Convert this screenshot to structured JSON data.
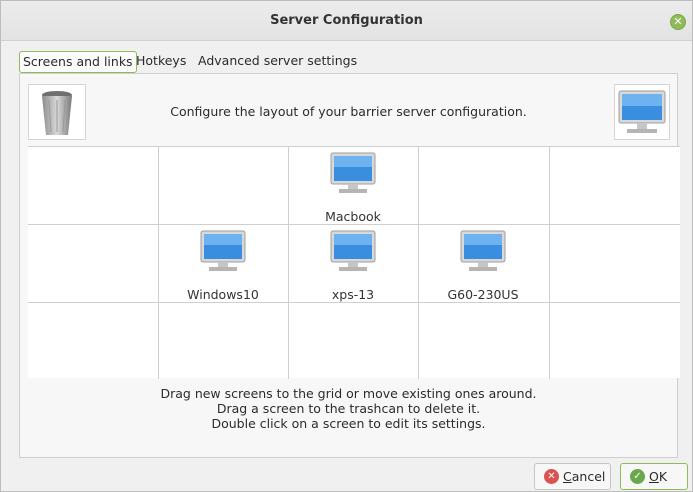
{
  "window": {
    "title": "Server Configuration",
    "close_icon": "close-icon"
  },
  "tabs": [
    {
      "label": "Screens and links",
      "active": true
    },
    {
      "label": "Hotkeys",
      "active": false
    },
    {
      "label": "Advanced server settings",
      "active": false
    }
  ],
  "panel": {
    "instruction": "Configure the layout of your barrier server configuration.",
    "trash_icon": "trash-icon",
    "new_screen_icon": "monitor-icon"
  },
  "grid": {
    "screens": [
      {
        "name": "Macbook"
      },
      {
        "name": "Windows10"
      },
      {
        "name": "xps-13"
      },
      {
        "name": "G60-230US"
      }
    ]
  },
  "help": {
    "line1": "Drag new screens to the grid or move existing ones around.",
    "line2": "Drag a screen to the trashcan to delete it.",
    "line3": "Double click on a screen to edit its settings."
  },
  "buttons": {
    "cancel_prefix": "",
    "cancel_accel": "C",
    "cancel_rest": "ancel",
    "ok_accel": "O",
    "ok_rest": "K",
    "cancel_color": "#d9534f",
    "ok_color": "#6aa84f"
  }
}
